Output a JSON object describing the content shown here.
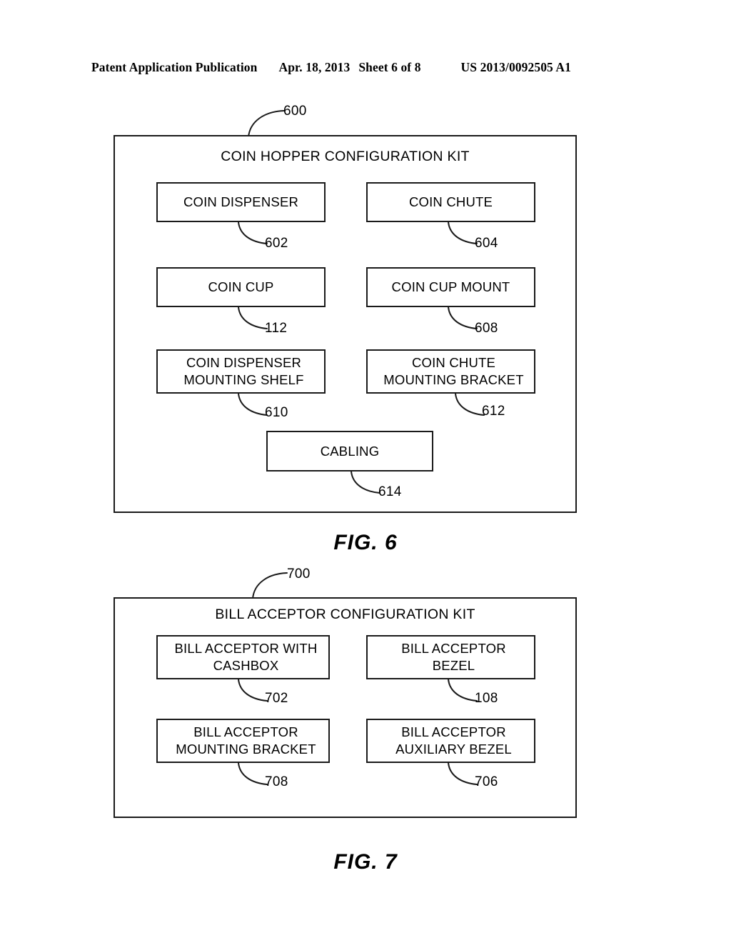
{
  "header": {
    "publication": "Patent Application Publication",
    "date": "Apr. 18, 2013",
    "sheet": "Sheet 6 of 8",
    "patent_number": "US 2013/0092505 A1"
  },
  "figures": [
    {
      "id": "fig6",
      "caption": "FIG. 6",
      "container_ref": "600",
      "title": "COIN HOPPER CONFIGURATION KIT",
      "nodes": [
        {
          "label_lines": [
            "COIN DISPENSER"
          ],
          "ref": "602"
        },
        {
          "label_lines": [
            "COIN CHUTE"
          ],
          "ref": "604"
        },
        {
          "label_lines": [
            "COIN CUP"
          ],
          "ref": "112"
        },
        {
          "label_lines": [
            "COIN CUP MOUNT"
          ],
          "ref": "608"
        },
        {
          "label_lines": [
            "COIN DISPENSER",
            "MOUNTING SHELF"
          ],
          "ref": "610"
        },
        {
          "label_lines": [
            "COIN CHUTE",
            "MOUNTING BRACKET"
          ],
          "ref": "612"
        },
        {
          "label_lines": [
            "CABLING"
          ],
          "ref": "614"
        }
      ]
    },
    {
      "id": "fig7",
      "caption": "FIG. 7",
      "container_ref": "700",
      "title": "BILL ACCEPTOR CONFIGURATION KIT",
      "nodes": [
        {
          "label_lines": [
            "BILL ACCEPTOR WITH",
            "CASHBOX"
          ],
          "ref": "702"
        },
        {
          "label_lines": [
            "BILL ACCEPTOR",
            "BEZEL"
          ],
          "ref": "108"
        },
        {
          "label_lines": [
            "BILL ACCEPTOR",
            "MOUNTING BRACKET"
          ],
          "ref": "708"
        },
        {
          "label_lines": [
            "BILL ACCEPTOR",
            "AUXILIARY BEZEL"
          ],
          "ref": "706"
        }
      ]
    }
  ],
  "colors": {
    "ink": "#1a1a1a",
    "paper": "#ffffff"
  }
}
